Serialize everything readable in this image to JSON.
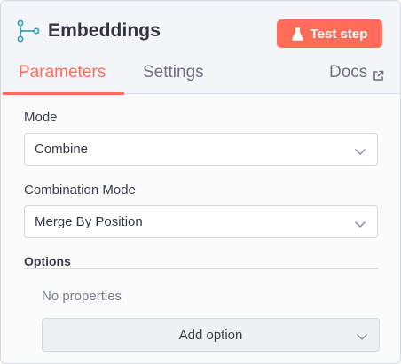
{
  "header": {
    "title": "Embeddings",
    "node_icon": "embeddings-node-icon",
    "test_step_label": "Test step",
    "test_step_icon": "flask-icon",
    "accent_color": "#ff6d5a"
  },
  "tabs": {
    "parameters": "Parameters",
    "settings": "Settings",
    "docs": "Docs",
    "active": "Parameters",
    "docs_icon": "external-link-icon"
  },
  "fields": {
    "mode": {
      "label": "Mode",
      "value": "Combine"
    },
    "combination_mode": {
      "label": "Combination Mode",
      "value": "Merge By Position"
    }
  },
  "options": {
    "title": "Options",
    "empty_text": "No properties",
    "add_option_label": "Add option"
  }
}
